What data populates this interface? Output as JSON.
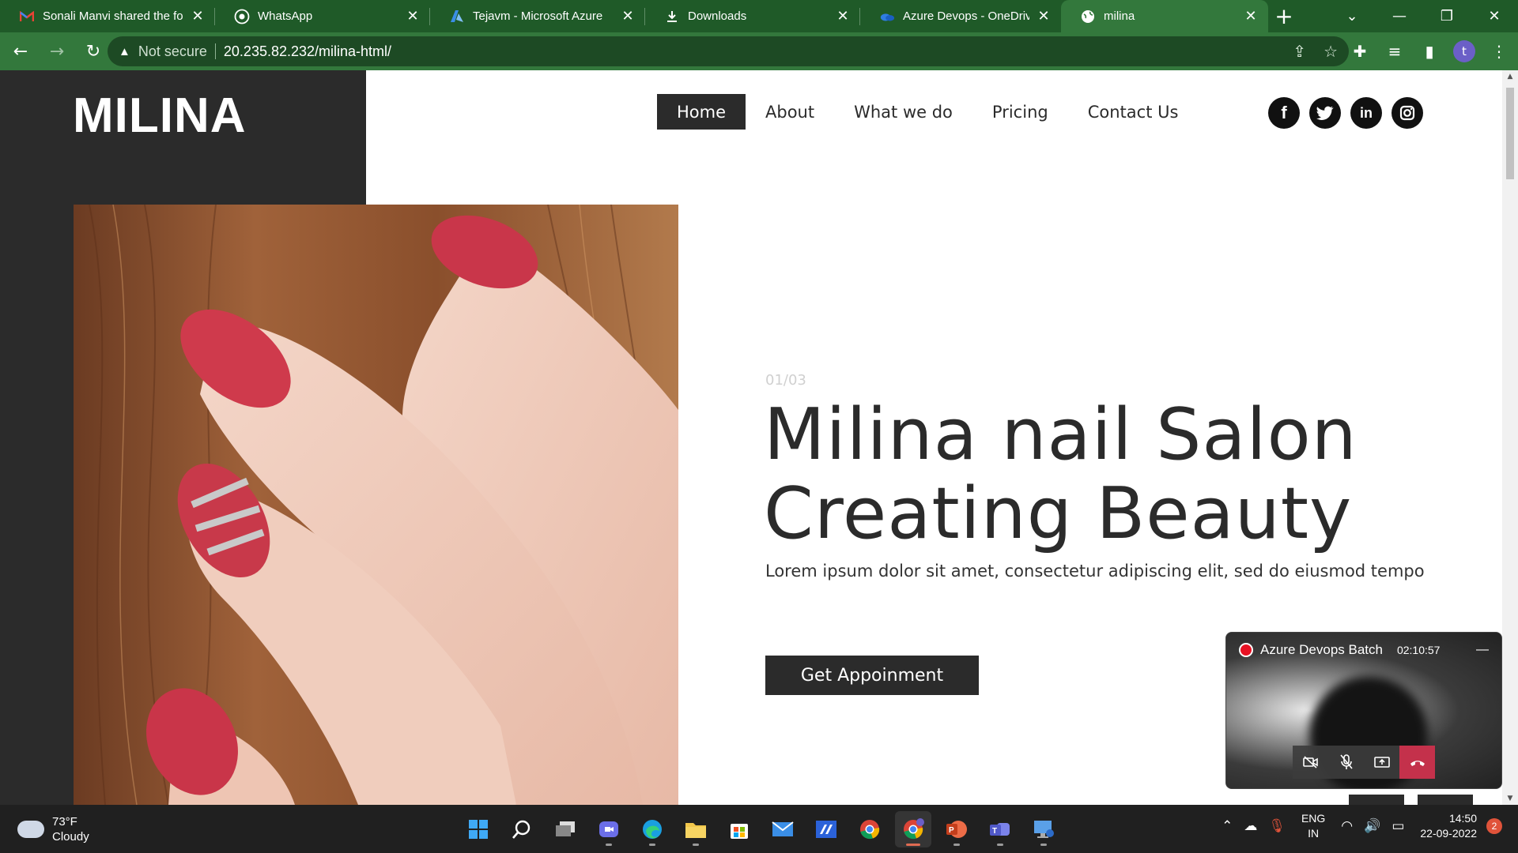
{
  "browser": {
    "tabs": [
      {
        "title": "Sonali Manvi shared the fol",
        "icon": "gmail-icon",
        "color": "#ea4335"
      },
      {
        "title": "WhatsApp",
        "icon": "whatsapp-icon",
        "color": "#25d366"
      },
      {
        "title": "Tejavm - Microsoft Azure",
        "icon": "azure-icon",
        "color": "#3a8ee6"
      },
      {
        "title": "Downloads",
        "icon": "download-icon",
        "color": "#ffffff"
      },
      {
        "title": "Azure Devops - OneDrive",
        "icon": "onedrive-icon",
        "color": "#2f7de1"
      },
      {
        "title": "milina",
        "icon": "globe-icon",
        "color": "#ffffff"
      }
    ],
    "active_tab_index": 5,
    "security_label": "Not secure",
    "url": "20.235.82.232/milina-html/",
    "profile_initial": "t",
    "theme_color": "#33783c"
  },
  "site": {
    "logo": "MILINA",
    "menu": [
      "Home",
      "About",
      "What we do",
      "Pricing",
      "Contact Us"
    ],
    "active_menu_index": 0,
    "socials": [
      {
        "name": "facebook-icon",
        "glyph": "f"
      },
      {
        "name": "twitter-icon",
        "glyph": "t"
      },
      {
        "name": "linkedin-icon",
        "glyph": "in"
      },
      {
        "name": "instagram-icon",
        "glyph": "◎"
      }
    ],
    "hero": {
      "counter": "01/03",
      "headline_line1": "Milina nail Salon",
      "headline_line2": "Creating Beauty",
      "subtext": "Lorem ipsum dolor sit amet, consectetur adipiscing elit, sed do eiusmod tempo",
      "cta": "Get Appoinment"
    },
    "dark_color": "#2b2b2b"
  },
  "call": {
    "title": "Azure Devops Batch",
    "timer": "02:10:57"
  },
  "taskbar": {
    "weather_temp": "73°F",
    "weather_desc": "Cloudy",
    "lang_1": "ENG",
    "lang_2": "IN",
    "time": "14:50",
    "date": "22-09-2022",
    "notifications": "2"
  }
}
